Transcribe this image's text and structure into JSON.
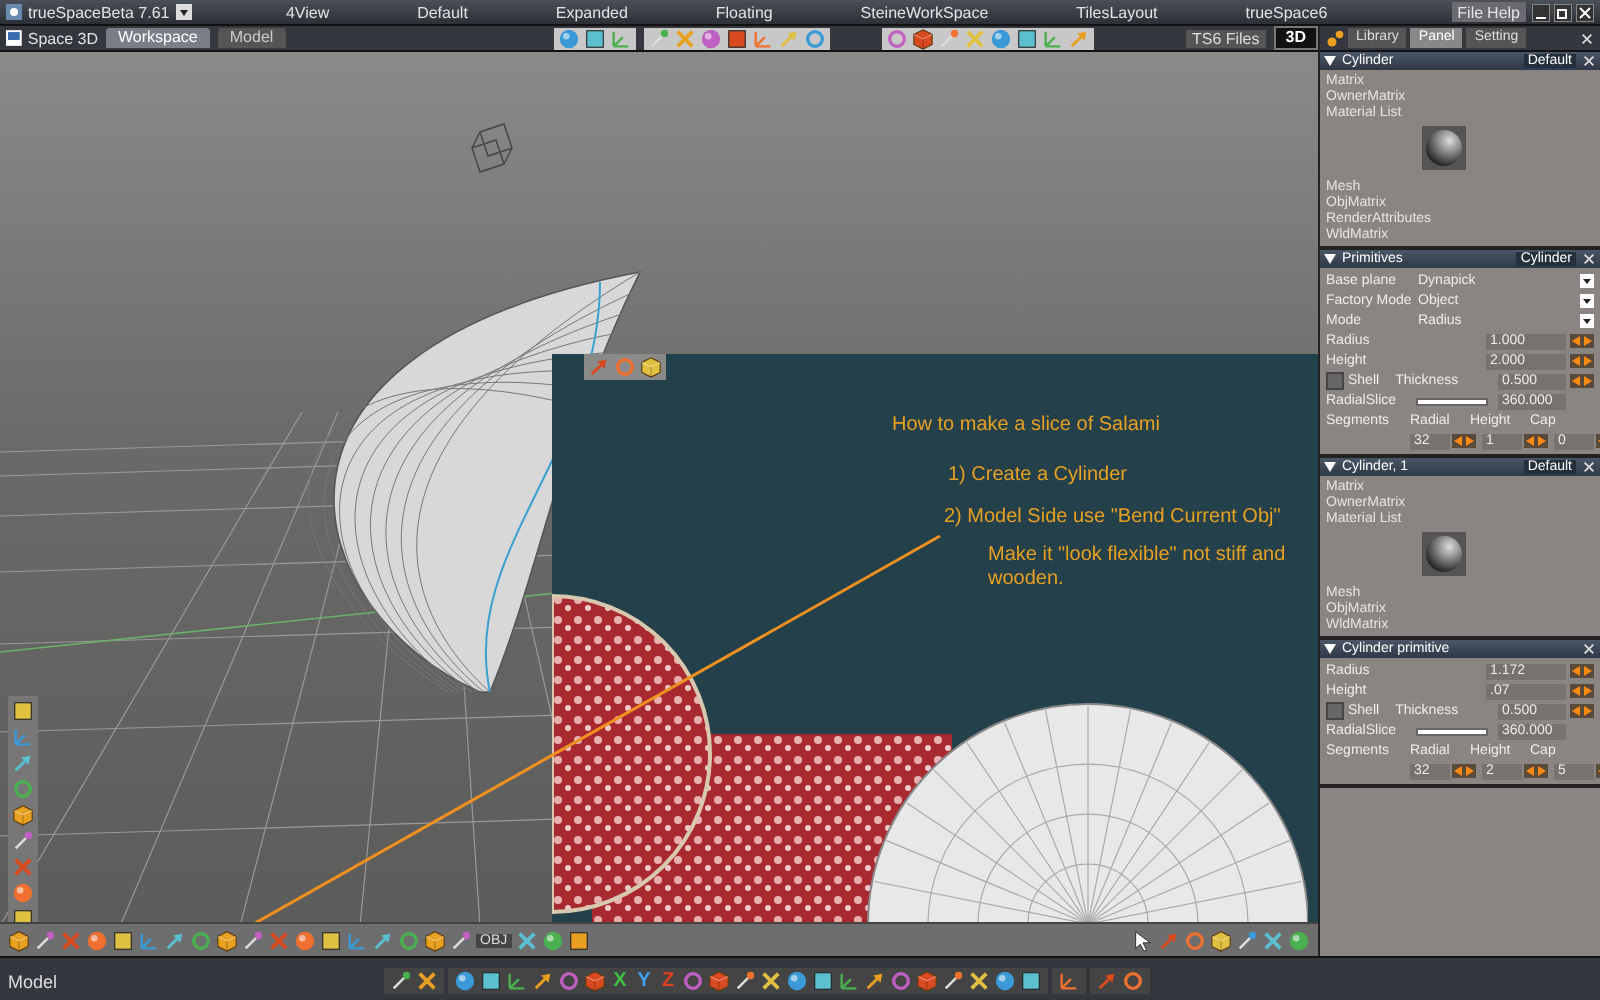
{
  "window": {
    "title": "trueSpaceBeta 7.61"
  },
  "layouts": [
    "4View",
    "Default",
    "Expanded",
    "Floating",
    "SteineWorkSpace",
    "TilesLayout",
    "trueSpace6"
  ],
  "menu": [
    "File",
    "Help"
  ],
  "view": {
    "title": "Space 3D",
    "tabs": [
      {
        "label": "Workspace",
        "selected": true
      },
      {
        "label": "Model",
        "selected": false
      }
    ]
  },
  "files_label": "TS6 Files",
  "mode_button": "3D",
  "panel_tabs": [
    {
      "label": "Library",
      "selected": false
    },
    {
      "label": "Panel",
      "selected": true
    },
    {
      "label": "Setting",
      "selected": false
    }
  ],
  "tutorial": {
    "title": "How to make a slice of Salami",
    "steps": [
      "1) Create a Cylinder",
      "2) Model Side use \"Bend Current Obj\""
    ],
    "note": "Make it \"look flexible\" not stiff and wooden."
  },
  "bottom_toolbar_label": "OBJ",
  "sections": [
    {
      "kind": "object",
      "title": "Cylinder",
      "preset": "Default",
      "items": [
        "Matrix",
        "OwnerMatrix",
        "Material List",
        "Mesh",
        "ObjMatrix",
        "RenderAttributes",
        "WldMatrix"
      ]
    },
    {
      "kind": "primitive",
      "title": "Primitives",
      "preset": "Cylinder",
      "dropdowns": [
        {
          "label": "Base plane",
          "value": "Dynapick"
        },
        {
          "label": "Factory Mode",
          "value": "Object"
        },
        {
          "label": "Mode",
          "value": "Radius"
        }
      ],
      "fields": [
        {
          "label": "Radius",
          "value": "1.000"
        },
        {
          "label": "Height",
          "value": "2.000"
        }
      ],
      "shell": {
        "label": "Shell",
        "checked": false,
        "thickness_label": "Thickness",
        "thickness": "0.500"
      },
      "slice": {
        "label": "RadialSlice",
        "level": 1,
        "value": "360.000"
      },
      "segments": {
        "label": "Segments",
        "parts": [
          {
            "label": "Radial",
            "value": "32"
          },
          {
            "label": "Height",
            "value": "1"
          },
          {
            "label": "Cap",
            "value": "0"
          }
        ]
      }
    },
    {
      "kind": "object",
      "title": "Cylinder, 1",
      "preset": "Default",
      "items": [
        "Matrix",
        "OwnerMatrix",
        "Material List",
        "Mesh",
        "ObjMatrix",
        "WldMatrix"
      ]
    },
    {
      "kind": "primitive",
      "title": "Cylinder primitive",
      "fields": [
        {
          "label": "Radius",
          "value": "1.172"
        },
        {
          "label": "Height",
          "value": ".07"
        }
      ],
      "shell": {
        "label": "Shell",
        "checked": false,
        "thickness_label": "Thickness",
        "thickness": "0.500"
      },
      "slice": {
        "label": "RadialSlice",
        "level": 1,
        "value": "360.000"
      },
      "segments": {
        "label": "Segments",
        "parts": [
          {
            "label": "Radial",
            "value": "32"
          },
          {
            "label": "Height",
            "value": "2"
          },
          {
            "label": "Cap",
            "value": "5"
          }
        ]
      }
    }
  ],
  "status": {
    "mode": "Model",
    "axes": [
      "X",
      "Y",
      "Z"
    ]
  }
}
